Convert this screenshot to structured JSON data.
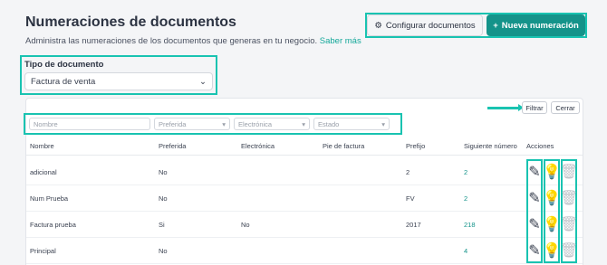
{
  "header": {
    "title": "Numeraciones de documentos",
    "subtitle": "Administra las numeraciones de los documentos que generas en tu negocio.",
    "learn_more": "Saber más",
    "config_button": "Configurar documentos",
    "new_button": "Nueva numeración"
  },
  "doc_type": {
    "label": "Tipo de documento",
    "value": "Factura de venta"
  },
  "filters": {
    "name_placeholder": "Nombre",
    "preferred": "Preferida",
    "electronic": "Electrónica",
    "status": "Estado",
    "filter_button": "Filtrar",
    "close_button": "Cerrar"
  },
  "table": {
    "columns": [
      "Nombre",
      "Preferida",
      "Electrónica",
      "Pie de factura",
      "Prefijo",
      "Siguiente número",
      "Acciones"
    ],
    "rows": [
      {
        "name": "adicional",
        "preferred": "No",
        "electronic": "",
        "footer": "",
        "prefix": "2",
        "next": "2"
      },
      {
        "name": "Num Prueba",
        "preferred": "No",
        "electronic": "",
        "footer": "",
        "prefix": "FV",
        "next": "2"
      },
      {
        "name": "Factura prueba",
        "preferred": "Si",
        "electronic": "No",
        "footer": "",
        "prefix": "2017",
        "next": "218"
      },
      {
        "name": "Principal",
        "preferred": "No",
        "electronic": "",
        "footer": "",
        "prefix": "",
        "next": "4"
      }
    ]
  },
  "icons": {
    "edit": "pencil-icon",
    "toggle": "lightbulb-icon",
    "delete": "trash-icon"
  },
  "colors": {
    "accent": "#14938a",
    "highlight": "#19c3b1"
  }
}
